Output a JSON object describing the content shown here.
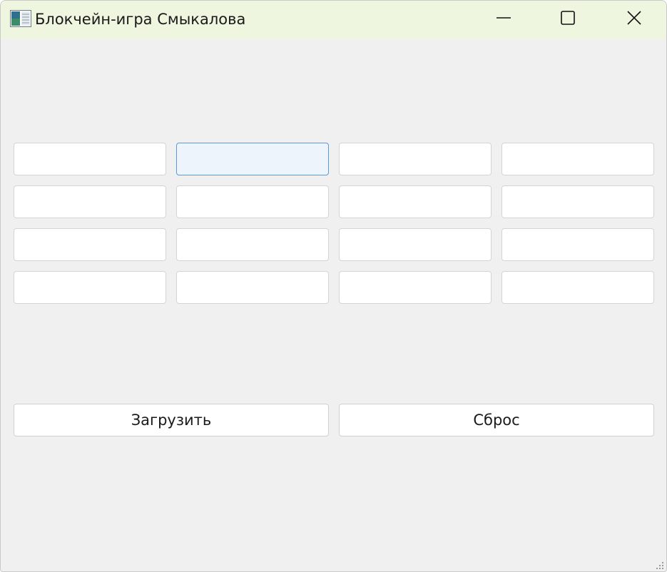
{
  "window": {
    "title": "Блокчейн-игра Смыкалова",
    "icons": {
      "app": "app-window-icon",
      "minimize": "minimize-icon",
      "maximize": "maximize-icon",
      "close": "close-icon",
      "resize": "resize-grip-icon"
    }
  },
  "grid": {
    "rows": 4,
    "columns": 4,
    "cells": [
      [
        "",
        "",
        "",
        ""
      ],
      [
        "",
        "",
        "",
        ""
      ],
      [
        "",
        "",
        "",
        ""
      ],
      [
        "",
        "",
        "",
        ""
      ]
    ],
    "focused_cell": [
      0,
      1
    ]
  },
  "buttons": {
    "load_label": "Загрузить",
    "reset_label": "Сброс"
  },
  "colors": {
    "titlebar": "#eef6e0",
    "window_bg": "#f0f0f0",
    "focus_border": "#5b9bd5",
    "focus_fill": "#eef4fb"
  }
}
